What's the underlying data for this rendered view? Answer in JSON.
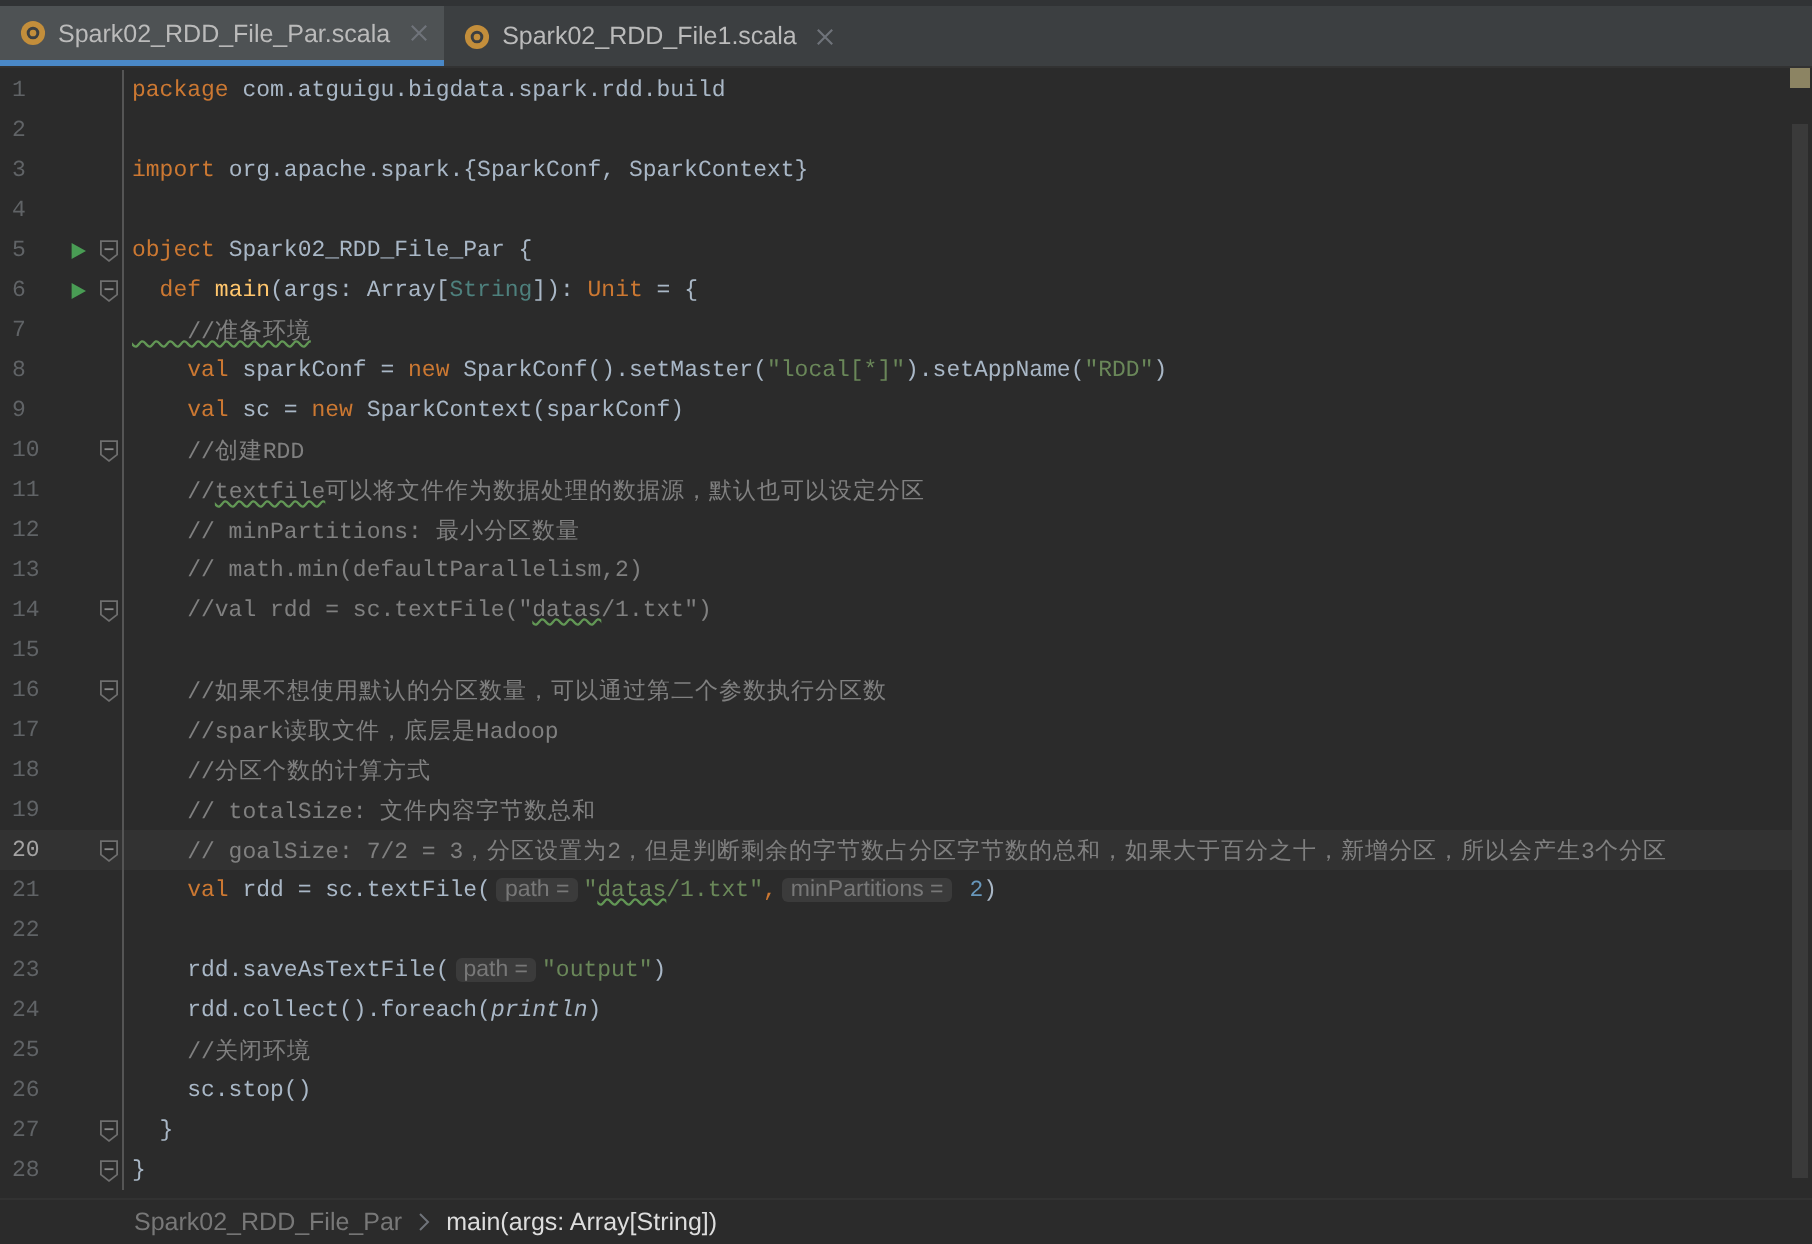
{
  "tabs": [
    {
      "label": "Spark02_RDD_File_Par.scala",
      "selected": true
    },
    {
      "label": "Spark02_RDD_File1.scala",
      "selected": false
    }
  ],
  "lines": [
    {
      "n": "1",
      "run": false,
      "fold": false,
      "current": false,
      "segs": [
        {
          "t": "package",
          "kind": "kw"
        },
        {
          "t": " com.atguigu.bigdata.spark.rdd.build",
          "kind": "id"
        }
      ]
    },
    {
      "n": "2",
      "run": false,
      "fold": false,
      "current": false
    },
    {
      "n": "3",
      "run": false,
      "fold": false,
      "current": false,
      "segs": [
        {
          "t": "import",
          "kind": "kw"
        },
        {
          "t": " org.apache.spark.{SparkConf, SparkContext}",
          "kind": "id"
        }
      ]
    },
    {
      "n": "4",
      "run": false,
      "fold": false,
      "current": false
    },
    {
      "n": "5",
      "run": true,
      "fold": true,
      "current": false,
      "segs": [
        {
          "t": "object",
          "kind": "kw"
        },
        {
          "t": " Spark02_RDD_File_Par {",
          "kind": "id"
        }
      ]
    },
    {
      "n": "6",
      "run": true,
      "fold": true,
      "current": false,
      "segs": [
        {
          "t": "  def ",
          "kind": "kw"
        },
        {
          "t": "main",
          "kind": "fn"
        },
        {
          "t": "(args: Array[",
          "kind": "id"
        },
        {
          "t": "String",
          "kind": "type"
        },
        {
          "t": "]): ",
          "kind": "id"
        },
        {
          "t": "Unit",
          "kind": "kw"
        },
        {
          "t": " = {",
          "kind": "id"
        }
      ]
    },
    {
      "n": "7",
      "run": false,
      "fold": false,
      "current": false,
      "segs": [
        {
          "t": "    //准备环境",
          "kind": "typo"
        }
      ]
    },
    {
      "n": "8",
      "run": false,
      "fold": false,
      "current": false,
      "segs": [
        {
          "t": "    val",
          "kind": "kw"
        },
        {
          "t": " sparkConf = ",
          "kind": "id"
        },
        {
          "t": "new",
          "kind": "kw"
        },
        {
          "t": " SparkConf().setMaster(",
          "kind": "id"
        },
        {
          "t": "\"local[*]\"",
          "kind": "str"
        },
        {
          "t": ").setAppName(",
          "kind": "id"
        },
        {
          "t": "\"RDD\"",
          "kind": "str"
        },
        {
          "t": ")",
          "kind": "id"
        }
      ]
    },
    {
      "n": "9",
      "run": false,
      "fold": false,
      "current": false,
      "segs": [
        {
          "t": "    val",
          "kind": "kw"
        },
        {
          "t": " sc = ",
          "kind": "id"
        },
        {
          "t": "new",
          "kind": "kw"
        },
        {
          "t": " SparkContext(sparkConf)",
          "kind": "id"
        }
      ]
    },
    {
      "n": "10",
      "run": false,
      "fold": true,
      "current": false,
      "segs": [
        {
          "t": "    //创建RDD",
          "kind": "cmt"
        }
      ]
    },
    {
      "n": "11",
      "run": false,
      "fold": false,
      "current": false,
      "segs": [
        {
          "t": "    //",
          "kind": "cmt"
        },
        {
          "t": "textfile",
          "kind": "typo"
        },
        {
          "t": "可以将文件作为数据处理的数据源，默认也可以设定分区",
          "kind": "cmt"
        }
      ]
    },
    {
      "n": "12",
      "run": false,
      "fold": false,
      "current": false,
      "segs": [
        {
          "t": "    // minPartitions: 最小分区数量",
          "kind": "cmt"
        }
      ]
    },
    {
      "n": "13",
      "run": false,
      "fold": false,
      "current": false,
      "segs": [
        {
          "t": "    // math.min(defaultParallelism,2)",
          "kind": "cmt"
        }
      ]
    },
    {
      "n": "14",
      "run": false,
      "fold": true,
      "current": false,
      "segs": [
        {
          "t": "    //val rdd = sc.textFile(\"",
          "kind": "cmt"
        },
        {
          "t": "datas",
          "kind": "typo"
        },
        {
          "t": "/1.txt\")",
          "kind": "cmt"
        }
      ]
    },
    {
      "n": "15",
      "run": false,
      "fold": false,
      "current": false
    },
    {
      "n": "16",
      "run": false,
      "fold": true,
      "current": false,
      "segs": [
        {
          "t": "    //如果不想使用默认的分区数量，可以通过第二个参数执行分区数",
          "kind": "cmt"
        }
      ]
    },
    {
      "n": "17",
      "run": false,
      "fold": false,
      "current": false,
      "segs": [
        {
          "t": "    //spark读取文件，底层是Hadoop",
          "kind": "cmt"
        }
      ]
    },
    {
      "n": "18",
      "run": false,
      "fold": false,
      "current": false,
      "segs": [
        {
          "t": "    //分区个数的计算方式",
          "kind": "cmt"
        }
      ]
    },
    {
      "n": "19",
      "run": false,
      "fold": false,
      "current": false,
      "segs": [
        {
          "t": "    // totalSize: 文件内容字节数总和",
          "kind": "cmt"
        }
      ]
    },
    {
      "n": "20",
      "run": false,
      "fold": true,
      "current": true,
      "segs": [
        {
          "t": "    // goalSize: 7/2 = 3，分区设置为2，但是判断剩余的字节数占分区字节数的总和，如果大于百分之十，新增分区，所以会产生3个分区",
          "kind": "cmt"
        }
      ]
    },
    {
      "n": "21",
      "run": false,
      "fold": false,
      "current": false,
      "segs": [
        {
          "t": "    val",
          "kind": "kw"
        },
        {
          "t": " rdd = sc.textFile(",
          "kind": "id"
        },
        {
          "t": "path =",
          "kind": "hint"
        },
        {
          "t": "\"",
          "kind": "str"
        },
        {
          "t": "datas",
          "kind": "strtypo"
        },
        {
          "t": "/1.txt\"",
          "kind": "str"
        },
        {
          "t": ",",
          "kind": "kw"
        },
        {
          "t": "minPartitions =",
          "kind": "hint"
        },
        {
          "t": "2",
          "kind": "num"
        },
        {
          "t": ")",
          "kind": "id"
        }
      ]
    },
    {
      "n": "22",
      "run": false,
      "fold": false,
      "current": false
    },
    {
      "n": "23",
      "run": false,
      "fold": false,
      "current": false,
      "segs": [
        {
          "t": "    rdd.saveAsTextFile(",
          "kind": "id"
        },
        {
          "t": "path =",
          "kind": "hint"
        },
        {
          "t": "\"output\"",
          "kind": "str"
        },
        {
          "t": ")",
          "kind": "id"
        }
      ]
    },
    {
      "n": "24",
      "run": false,
      "fold": false,
      "current": false,
      "segs": [
        {
          "t": "    rdd.collect().foreach(",
          "kind": "id"
        },
        {
          "t": "println",
          "kind": "ital"
        },
        {
          "t": ")",
          "kind": "id"
        }
      ]
    },
    {
      "n": "25",
      "run": false,
      "fold": false,
      "current": false,
      "segs": [
        {
          "t": "    //关闭环境",
          "kind": "cmt"
        }
      ]
    },
    {
      "n": "26",
      "run": false,
      "fold": false,
      "current": false,
      "segs": [
        {
          "t": "    sc.stop()",
          "kind": "id"
        }
      ]
    },
    {
      "n": "27",
      "run": false,
      "fold": true,
      "current": false,
      "segs": [
        {
          "t": "  }",
          "kind": "id"
        }
      ]
    },
    {
      "n": "28",
      "run": false,
      "fold": true,
      "current": false,
      "segs": [
        {
          "t": "}",
          "kind": "id"
        }
      ]
    }
  ],
  "breadcrumb": [
    {
      "label": "Spark02_RDD_File_Par",
      "selected": false
    },
    {
      "label": "main(args: Array[String])",
      "selected": true
    }
  ]
}
